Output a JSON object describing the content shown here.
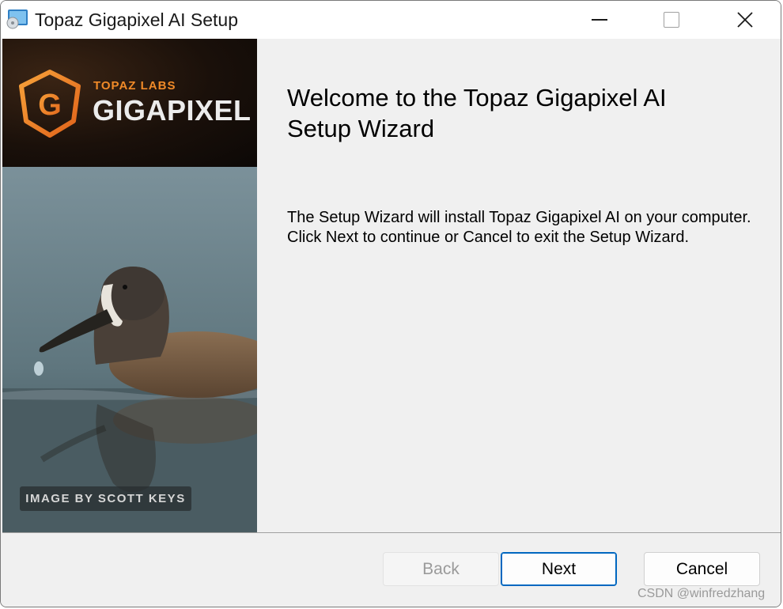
{
  "window": {
    "title": "Topaz Gigapixel AI Setup",
    "icons": {
      "app": "installer-cd-icon",
      "minimize": "minimize-icon",
      "maximize": "maximize-icon",
      "close": "close-icon"
    }
  },
  "banner": {
    "brand_small": "TOPAZ LABS",
    "brand_big": "GIGAPIXEL",
    "logo_letter": "G",
    "image_credit": "IMAGE BY SCOTT KEYS",
    "accent_color": "#f08a28"
  },
  "content": {
    "heading": "Welcome to the Topaz Gigapixel AI Setup Wizard",
    "description": "The Setup Wizard will install Topaz Gigapixel AI on your computer. Click Next to continue or Cancel to exit the Setup Wizard."
  },
  "buttons": {
    "back": "Back",
    "next": "Next",
    "cancel": "Cancel",
    "focus_color": "#0067c0"
  },
  "watermark": "CSDN @winfredzhang"
}
